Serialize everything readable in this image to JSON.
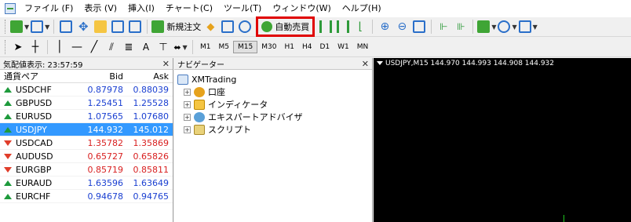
{
  "menu": [
    "ファイル (F)",
    "表示 (V)",
    "挿入(I)",
    "チャート(C)",
    "ツール(T)",
    "ウィンドウ(W)",
    "ヘルプ(H)"
  ],
  "toolbar1": {
    "new_order_label": "新規注文",
    "auto_trade_label": "自動売買",
    "auto_trade_highlight_color": "#e00000"
  },
  "toolbar2": {
    "timeframes": [
      "M1",
      "M5",
      "M15",
      "M30",
      "H1",
      "H4",
      "D1",
      "W1",
      "MN"
    ],
    "active_timeframe": "M15",
    "text_tool_label": "A"
  },
  "market_watch": {
    "title": "気配値表示: 23:57:59",
    "columns": [
      "通貨ペア",
      "Bid",
      "Ask"
    ],
    "rows": [
      {
        "symbol": "USDCHF",
        "bid": "0.87978",
        "ask": "0.88039",
        "direction": "up"
      },
      {
        "symbol": "GBPUSD",
        "bid": "1.25451",
        "ask": "1.25528",
        "direction": "up"
      },
      {
        "symbol": "EURUSD",
        "bid": "1.07565",
        "ask": "1.07680",
        "direction": "up"
      },
      {
        "symbol": "USDJPY",
        "bid": "144.932",
        "ask": "145.012",
        "direction": "up"
      },
      {
        "symbol": "USDCAD",
        "bid": "1.35782",
        "ask": "1.35869",
        "direction": "down"
      },
      {
        "symbol": "AUDUSD",
        "bid": "0.65727",
        "ask": "0.65826",
        "direction": "down"
      },
      {
        "symbol": "EURGBP",
        "bid": "0.85719",
        "ask": "0.85811",
        "direction": "down"
      },
      {
        "symbol": "EURAUD",
        "bid": "1.63596",
        "ask": "1.63649",
        "direction": "up"
      },
      {
        "symbol": "EURCHF",
        "bid": "0.94678",
        "ask": "0.94765",
        "direction": "up"
      }
    ],
    "selected_symbol": "USDJPY"
  },
  "navigator": {
    "title": "ナビゲーター",
    "root": "XMTrading",
    "items": [
      "口座",
      "インディケータ",
      "エキスパートアドバイザ",
      "スクリプト"
    ]
  },
  "chart": {
    "info": "USDJPY,M15  144.970 144.993 144.908 144.932",
    "background": "#000000",
    "candle_color": "#1ec51e"
  }
}
